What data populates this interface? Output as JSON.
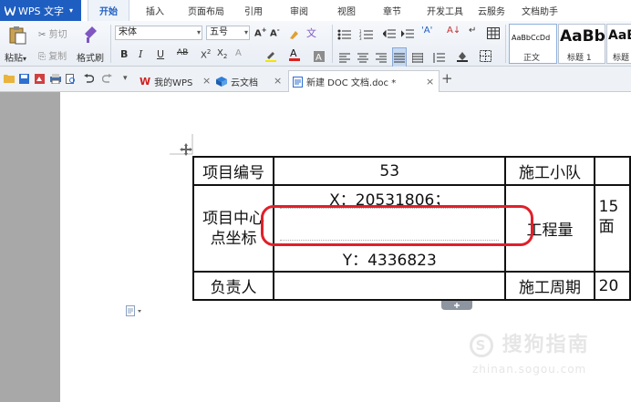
{
  "app": {
    "name": "WPS 文字",
    "menu_arrow": "▾"
  },
  "menu": {
    "tabs": [
      "开始",
      "插入",
      "页面布局",
      "引用",
      "审阅",
      "视图",
      "章节",
      "开发工具",
      "云服务",
      "文档助手"
    ],
    "active_index": 0
  },
  "ribbon": {
    "paste": "粘贴",
    "cut": "剪切",
    "copy": "复制",
    "format_painter": "格式刷",
    "font_name": "宋体",
    "font_size": "五号",
    "styles": [
      {
        "preview": "AaBbCcDd",
        "label": "正文"
      },
      {
        "preview": "AaBb",
        "label": "标题 1"
      },
      {
        "preview": "AaB",
        "label": "标题"
      }
    ]
  },
  "tabstrip": {
    "tabs": [
      {
        "label": "我的WPS",
        "close": "×"
      },
      {
        "label": "云文档",
        "close": "×"
      },
      {
        "label": "新建 DOC 文档.doc *",
        "close": "×"
      }
    ],
    "new_tab": "+"
  },
  "table": {
    "row1": {
      "c1": "项目编号",
      "c2": "53",
      "c3": "施工小队",
      "c4": ""
    },
    "row2": {
      "c1": "项目中心点坐标",
      "c2_top": "X：20531806；",
      "c2_bottom": "Y：4336823",
      "c3": "工程量",
      "c4_top": "15",
      "c4_bottom": "面"
    },
    "row3": {
      "c1": "负责人",
      "c2": "",
      "c3": "施工周期",
      "c4": "20"
    }
  },
  "watermark": {
    "main": "搜狗指南",
    "sub": "zhinan.sogou.com"
  },
  "colors": {
    "accent": "#1f5ec1",
    "annotation": "#e0202a"
  }
}
